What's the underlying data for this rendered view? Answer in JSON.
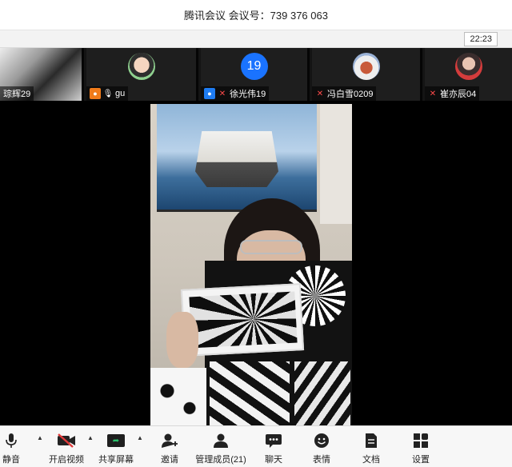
{
  "window": {
    "title": "腾讯会议 会议号：739 376 063",
    "time": "22:23"
  },
  "participants": [
    {
      "name": "琮辉29",
      "kind": "video"
    },
    {
      "name": "gu",
      "kind": "avatar",
      "badge": "person-orange",
      "mic": "on"
    },
    {
      "name": "徐光伟19",
      "kind": "number",
      "avatar_text": "19",
      "badge": "person-blue",
      "mic": "muted"
    },
    {
      "name": "冯白雪0209",
      "kind": "avatar",
      "mic": "muted"
    },
    {
      "name": "崔亦辰04",
      "kind": "avatar",
      "mic": "muted"
    }
  ],
  "toolbar": {
    "mute": "静音",
    "video": "开启视频",
    "share": "共享屏幕",
    "invite": "邀请",
    "members": "管理成员(21)",
    "chat": "聊天",
    "reactions": "表情",
    "docs": "文档",
    "settings": "设置"
  },
  "icons": {
    "mic": "mic-icon",
    "video_off": "video-off-icon",
    "share": "share-screen-icon",
    "invite": "invite-icon",
    "members": "members-icon",
    "chat": "chat-icon",
    "reactions": "emoji-icon",
    "docs": "document-icon",
    "settings": "settings-icon"
  },
  "colors": {
    "accent_blue": "#1e7cf2",
    "accent_orange": "#f07b1a",
    "muted_red": "#ff4a4a",
    "share_green": "#29c26a"
  }
}
